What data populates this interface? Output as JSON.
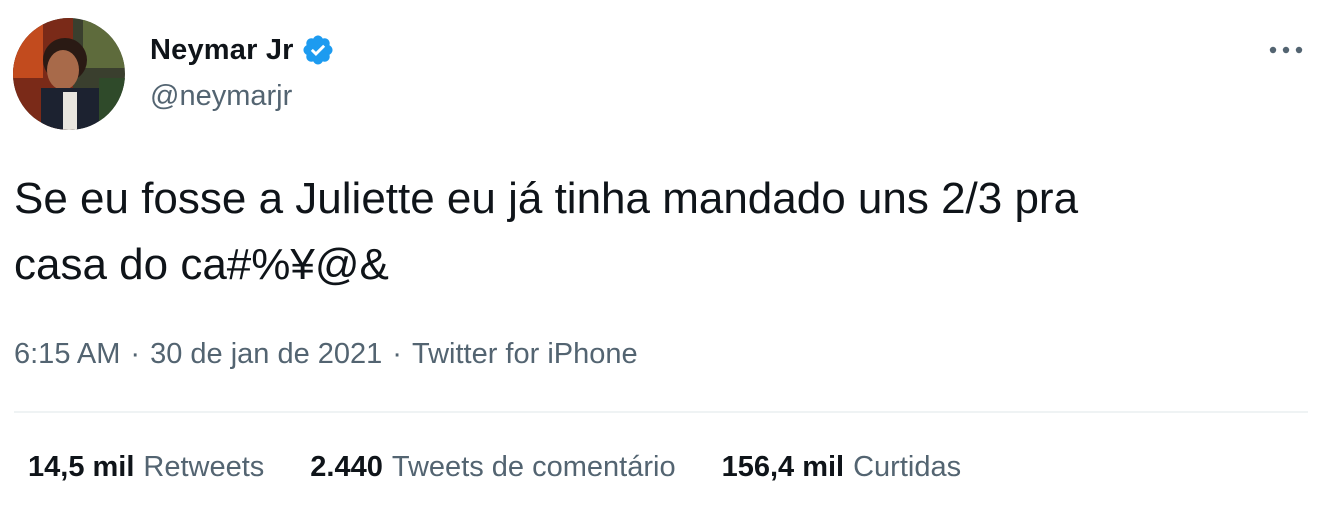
{
  "author": {
    "display_name": "Neymar Jr",
    "handle": "@neymarjr",
    "verified_icon": "verified-badge-icon",
    "avatar_icon": "profile-photo"
  },
  "menu": {
    "more_icon": "more-options-icon"
  },
  "tweet": {
    "text": "Se eu fosse a Juliette eu já tinha mandado uns 2/3 pra\ncasa do ca#%¥@&"
  },
  "meta": {
    "time": "6:15 AM",
    "separator_1": "·",
    "date": "30 de jan de 2021",
    "separator_2": "·",
    "source": "Twitter for iPhone"
  },
  "stats": {
    "retweets": {
      "count": "14,5 mil",
      "label": "Retweets"
    },
    "quotes": {
      "count": "2.440",
      "label": "Tweets de comentário"
    },
    "likes": {
      "count": "156,4 mil",
      "label": "Curtidas"
    }
  },
  "colors": {
    "text_primary": "#0f1419",
    "text_secondary": "#536471",
    "verified_blue": "#1d9bf0",
    "divider": "#eff3f4"
  }
}
